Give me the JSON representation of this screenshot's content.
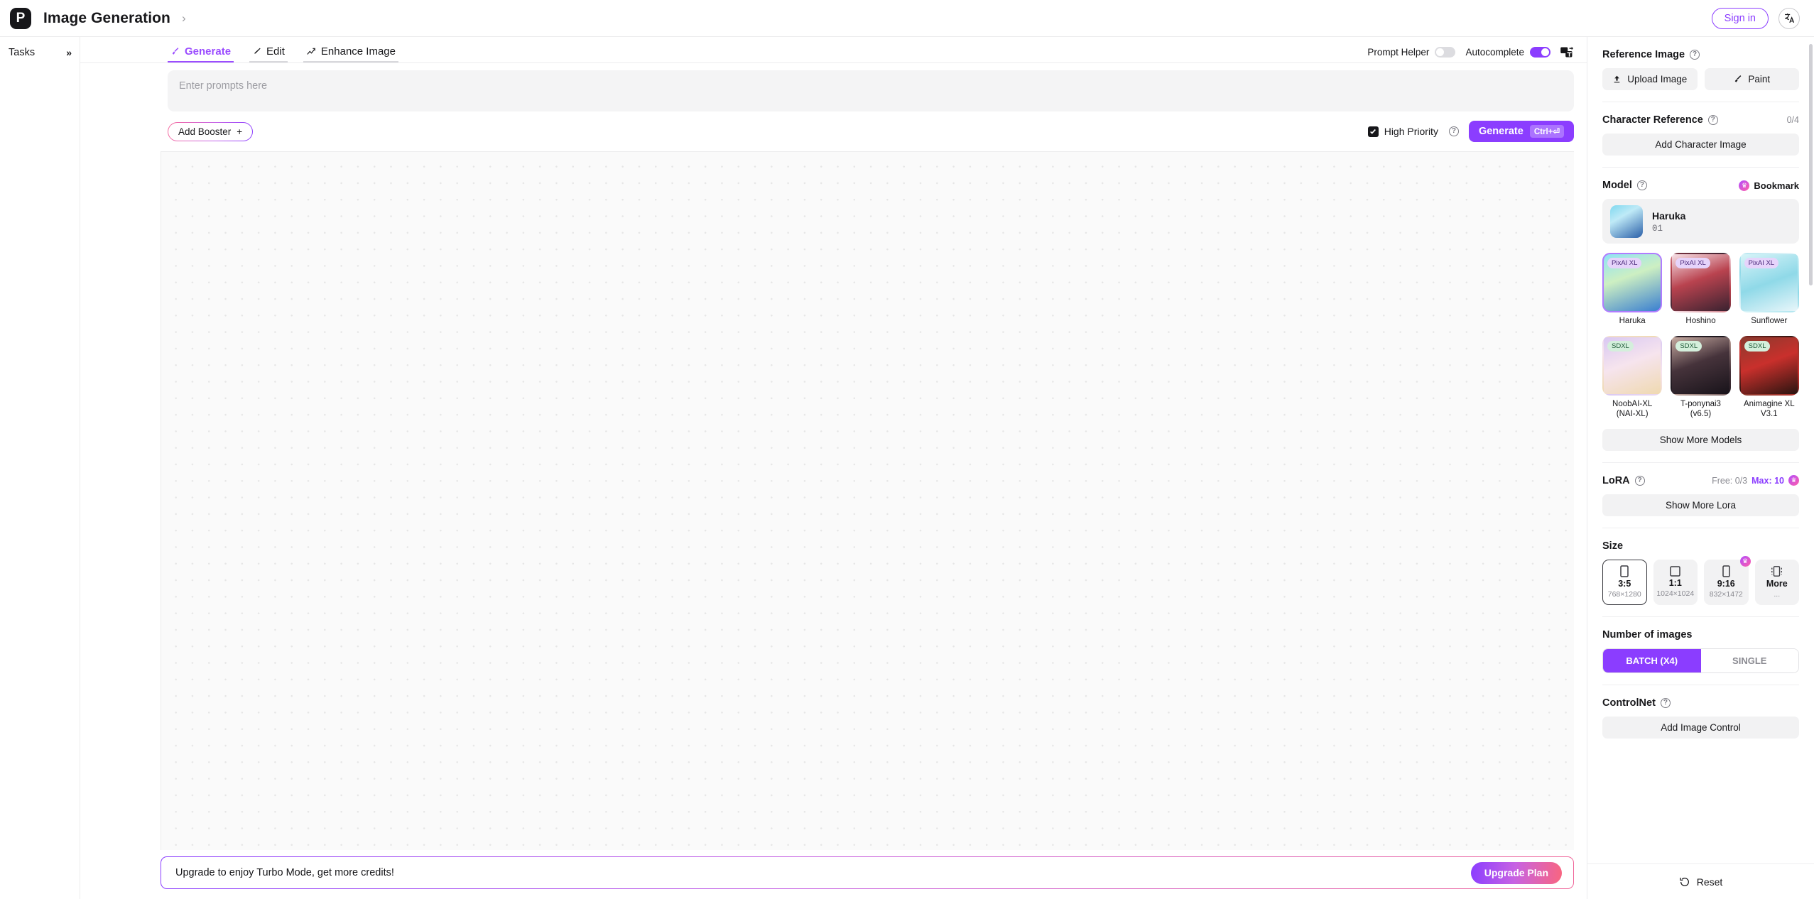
{
  "header": {
    "logo_text": "P",
    "title": "Image Generation",
    "breadcrumb_chevron": "›",
    "signin_label": "Sign in",
    "lang_icon": "translate-icon"
  },
  "tasks_rail": {
    "label": "Tasks",
    "expand_icon": "»"
  },
  "tabs": [
    {
      "label": "Generate",
      "icon": "brush-icon",
      "active": true
    },
    {
      "label": "Edit",
      "icon": "pencil-icon",
      "active": false
    },
    {
      "label": "Enhance Image",
      "icon": "enhance-icon",
      "active": false
    }
  ],
  "toolbar": {
    "prompt_helper_label": "Prompt Helper",
    "prompt_helper_on": false,
    "autocomplete_label": "Autocomplete",
    "autocomplete_on": true,
    "image_to_text_icon": "image-to-text-icon"
  },
  "prompt": {
    "placeholder": "Enter prompts here",
    "value": "",
    "booster_label": "Add Booster",
    "booster_plus": "+",
    "high_priority_label": "High Priority",
    "high_priority_checked": true,
    "generate_label": "Generate",
    "generate_shortcut": "Ctrl+⏎"
  },
  "banner": {
    "text": "Upgrade to enjoy Turbo Mode, get more credits!",
    "button_label": "Upgrade Plan"
  },
  "sidebar": {
    "reference_image": {
      "title": "Reference Image",
      "upload_label": "Upload Image",
      "paint_label": "Paint"
    },
    "character_reference": {
      "title": "Character Reference",
      "counter": "0/4",
      "add_label": "Add Character Image"
    },
    "model": {
      "title": "Model",
      "bookmark_label": "Bookmark",
      "selected_name": "Haruka",
      "selected_sub": "01",
      "cards": [
        {
          "label": "Haruka",
          "badge": "PixAI XL",
          "badge_type": "pixai",
          "selected": true
        },
        {
          "label": "Hoshino",
          "badge": "PixAI XL",
          "badge_type": "pixai",
          "selected": false
        },
        {
          "label": "Sunflower",
          "badge": "PixAI XL",
          "badge_type": "pixai",
          "selected": false
        },
        {
          "label": "NoobAI-XL (NAI-XL)",
          "badge": "SDXL",
          "badge_type": "sdxl",
          "selected": false
        },
        {
          "label": "T-ponynai3 (v6.5)",
          "badge": "SDXL",
          "badge_type": "sdxl",
          "selected": false
        },
        {
          "label": "Animagine XL V3.1",
          "badge": "SDXL",
          "badge_type": "sdxl",
          "selected": false
        }
      ],
      "show_more_label": "Show More Models"
    },
    "lora": {
      "title": "LoRA",
      "free_label": "Free: 0/3",
      "max_label": "Max: 10",
      "show_more_label": "Show More Lora"
    },
    "size": {
      "title": "Size",
      "options": [
        {
          "ratio": "3:5",
          "dims": "768×1280",
          "selected": true,
          "premium": false
        },
        {
          "ratio": "1:1",
          "dims": "1024×1024",
          "selected": false,
          "premium": false
        },
        {
          "ratio": "9:16",
          "dims": "832×1472",
          "selected": false,
          "premium": true
        },
        {
          "ratio": "More",
          "dims": "...",
          "selected": false,
          "premium": false
        }
      ]
    },
    "number_of_images": {
      "title": "Number of images",
      "batch_label": "BATCH (X4)",
      "single_label": "SINGLE",
      "selected": "batch"
    },
    "controlnet": {
      "title": "ControlNet",
      "add_label": "Add Image Control"
    },
    "reset_label": "Reset"
  },
  "colors": {
    "accent": "#8b3dff",
    "accent_light": "#9b4dff",
    "pink": "#f0689b",
    "panel": "#f2f2f3"
  }
}
